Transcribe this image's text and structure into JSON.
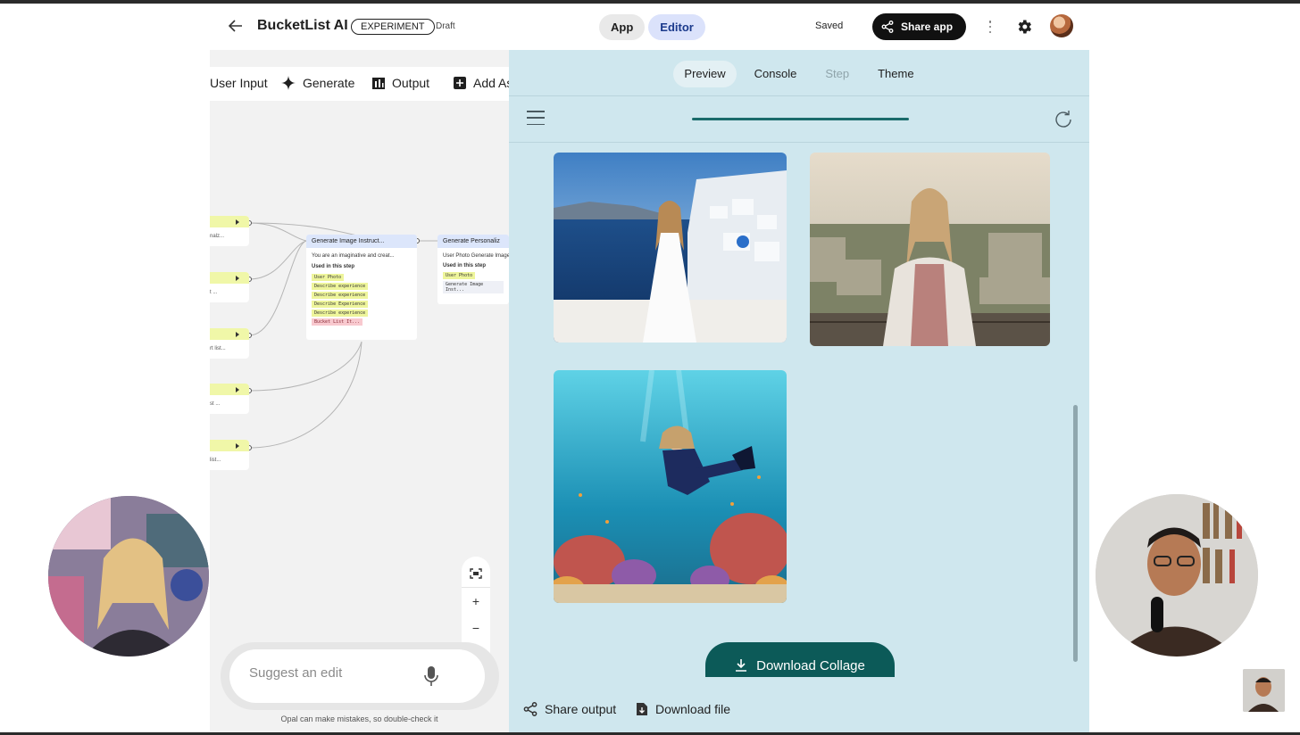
{
  "header": {
    "title": "BucketList AI",
    "badge": "EXPERIMENT",
    "status": "Draft",
    "mode_tabs": [
      "App",
      "Editor"
    ],
    "active_mode": "Editor",
    "saved": "Saved",
    "share_label": "Share app"
  },
  "canvas": {
    "toolbar": {
      "user_input": "User Input",
      "generate": "Generate",
      "output": "Output",
      "add_asset": "Add As"
    },
    "node_stubs": [
      "nalz...",
      "t ...",
      "rt list...",
      "st ...",
      "list..."
    ],
    "node_image": {
      "title": "Generate Image Instruct...",
      "desc": "You are an imaginative and creat...",
      "used_label": "Used in this step",
      "chips": [
        "User Photo",
        "Describe experience",
        "Describe experience",
        "Describe Experience",
        "Describe experience"
      ],
      "chip_pink": "Bucket List It..."
    },
    "node_personal": {
      "title": "Generate Personaliz",
      "desc": "User Photo Generate Image",
      "used_label": "Used in this step",
      "chip_user": "User Photo",
      "chip_gen": "Generate Image Inst..."
    },
    "suggest_placeholder": "Suggest an edit",
    "disclaimer": "Opal can make mistakes, so double-check it"
  },
  "preview": {
    "tabs": [
      "Preview",
      "Console",
      "Step",
      "Theme"
    ],
    "active_tab": "Preview",
    "disabled_tab": "Step",
    "download_collage": "Download Collage",
    "share_output": "Share output",
    "download_file": "Download file"
  },
  "colors": {
    "panel_bg": "#cfe7ee",
    "accent_teal": "#0c5a58",
    "editor_tab": "#dbe2fb"
  }
}
